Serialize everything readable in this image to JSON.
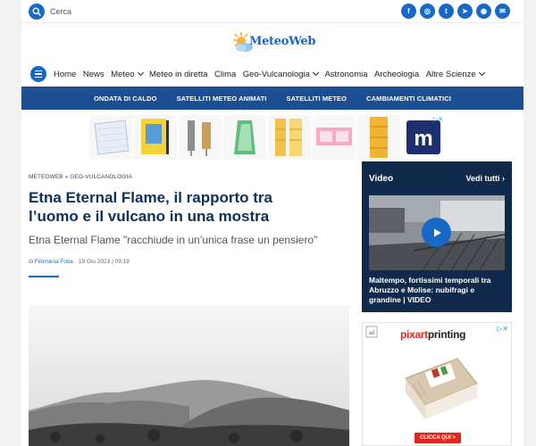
{
  "search": {
    "placeholder": "Cerca"
  },
  "socials": [
    {
      "icon": "facebook-icon",
      "glyph": "f"
    },
    {
      "icon": "instagram-icon",
      "glyph": "◎"
    },
    {
      "icon": "twitter-icon",
      "glyph": "t"
    },
    {
      "icon": "telegram-icon",
      "glyph": "➤"
    },
    {
      "icon": "rss-icon",
      "glyph": "◉"
    },
    {
      "icon": "mail-icon",
      "glyph": "✉"
    }
  ],
  "logo": {
    "text": "MeteoWeb"
  },
  "nav": {
    "items": [
      {
        "label": "Home",
        "dropdown": false
      },
      {
        "label": "News",
        "dropdown": false
      },
      {
        "label": "Meteo",
        "dropdown": true
      },
      {
        "label": "Meteo in diretta",
        "dropdown": false
      },
      {
        "label": "Clima",
        "dropdown": false
      },
      {
        "label": "Geo-Vulcanologia",
        "dropdown": true
      },
      {
        "label": "Astronomia",
        "dropdown": false
      },
      {
        "label": "Archeologia",
        "dropdown": false
      },
      {
        "label": "Altre Scienze",
        "dropdown": true
      }
    ]
  },
  "subnav": {
    "items": [
      "ONDATA DI CALDO",
      "SATELLITI METEO ANIMATI",
      "SATELLITI METEO",
      "CAMBIAMENTI CLIMATICI"
    ]
  },
  "article": {
    "breadcrumb": "METEOWEB » GEO-VULCANOLOGIA",
    "title": "Etna Eternal Flame, il rapporto tra l’uomo e il vulcano in una mostra",
    "subtitle": "Etna Eternal Flame \"racchiude in un’unica frase un pensiero\"",
    "author_prefix": "di ",
    "author": "Filomena Fotia",
    "date": "19 Giu 2023 | 09:19"
  },
  "video": {
    "heading": "Video",
    "see_all": "Vedi tutti",
    "caption": "Maltempo, fortissimi temporali tra Abruzzo e Molise: nubifragi e grandine | VIDEO"
  },
  "ad": {
    "brand_red": "pixart",
    "brand_dark": "printing",
    "cta": "CLICCA QUI >"
  },
  "colors": {
    "accent": "#1769c5",
    "navy": "#1c4f91",
    "title": "#0e2f5a",
    "video_bg": "#102a4c"
  }
}
